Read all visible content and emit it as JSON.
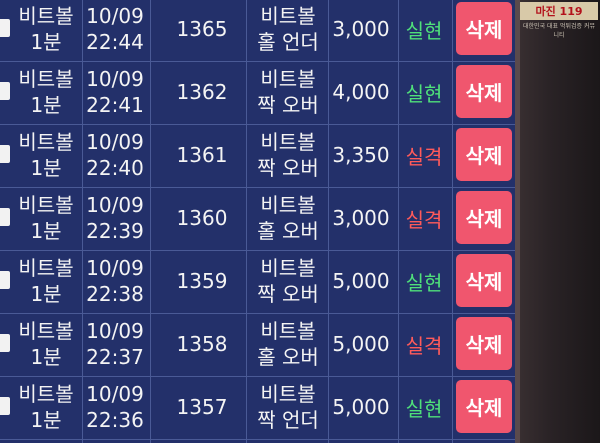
{
  "rows": [
    {
      "game": [
        "비트볼",
        "1분"
      ],
      "date": "10/09",
      "time": "22:44",
      "round": "1365",
      "pick": [
        "비트볼",
        "홀 언더"
      ],
      "amount": "3,000",
      "result": "실현",
      "result_type": "win",
      "delete": "삭제"
    },
    {
      "game": [
        "비트볼",
        "1분"
      ],
      "date": "10/09",
      "time": "22:41",
      "round": "1362",
      "pick": [
        "비트볼",
        "짝 오버"
      ],
      "amount": "4,000",
      "result": "실현",
      "result_type": "win",
      "delete": "삭제"
    },
    {
      "game": [
        "비트볼",
        "1분"
      ],
      "date": "10/09",
      "time": "22:40",
      "round": "1361",
      "pick": [
        "비트볼",
        "짝 오버"
      ],
      "amount": "3,350",
      "result": "실격",
      "result_type": "lose",
      "delete": "삭제"
    },
    {
      "game": [
        "비트볼",
        "1분"
      ],
      "date": "10/09",
      "time": "22:39",
      "round": "1360",
      "pick": [
        "비트볼",
        "홀 오버"
      ],
      "amount": "3,000",
      "result": "실격",
      "result_type": "lose",
      "delete": "삭제"
    },
    {
      "game": [
        "비트볼",
        "1분"
      ],
      "date": "10/09",
      "time": "22:38",
      "round": "1359",
      "pick": [
        "비트볼",
        "짝 오버"
      ],
      "amount": "5,000",
      "result": "실현",
      "result_type": "win",
      "delete": "삭제"
    },
    {
      "game": [
        "비트볼",
        "1분"
      ],
      "date": "10/09",
      "time": "22:37",
      "round": "1358",
      "pick": [
        "비트볼",
        "홀 오버"
      ],
      "amount": "5,000",
      "result": "실격",
      "result_type": "lose",
      "delete": "삭제"
    },
    {
      "game": [
        "비트볼",
        "1분"
      ],
      "date": "10/09",
      "time": "22:36",
      "round": "1357",
      "pick": [
        "비트볼",
        "짝 언더"
      ],
      "amount": "5,000",
      "result": "실현",
      "result_type": "win",
      "delete": "삭제"
    }
  ],
  "watermark": {
    "logo": "마진 119",
    "sub": "대한민국 대표 먹튀검증 커뮤니티"
  },
  "colors": {
    "background": "#23306a",
    "win": "#4fe07a",
    "lose": "#ff5a5a",
    "delete_button": "#f0566e"
  }
}
